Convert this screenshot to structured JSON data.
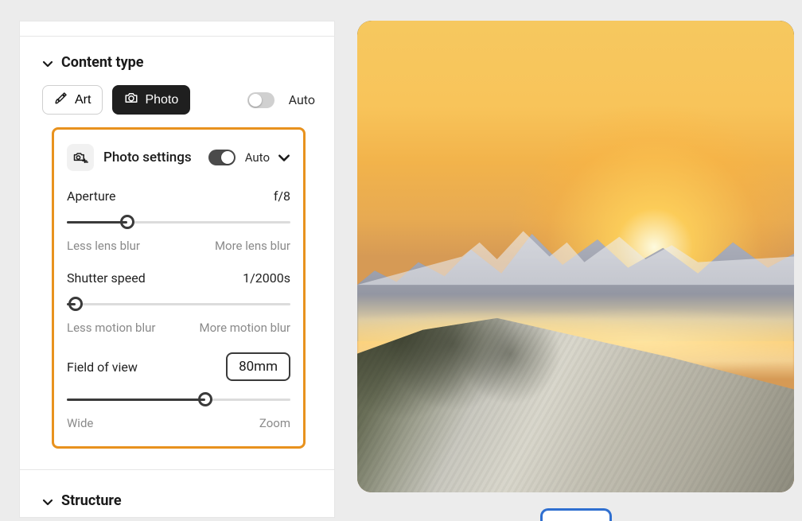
{
  "sections": {
    "content_type": {
      "title": "Content type"
    },
    "structure": {
      "title": "Structure"
    }
  },
  "type_buttons": {
    "art": {
      "label": "Art"
    },
    "photo": {
      "label": "Photo"
    }
  },
  "type_auto": {
    "label": "Auto",
    "on": false
  },
  "photo_settings": {
    "title": "Photo settings",
    "auto": {
      "label": "Auto",
      "on": true
    },
    "aperture": {
      "label": "Aperture",
      "value": "f/8",
      "percent": 27,
      "hint_low": "Less lens blur",
      "hint_high": "More lens blur"
    },
    "shutter": {
      "label": "Shutter speed",
      "value": "1/2000s",
      "percent": 4,
      "hint_low": "Less motion blur",
      "hint_high": "More motion blur"
    },
    "fov": {
      "label": "Field of view",
      "value": "80mm",
      "percent": 62,
      "hint_low": "Wide",
      "hint_high": "Zoom"
    }
  },
  "colors": {
    "highlight": "#e8921e",
    "accent_blue": "#2f6fd0"
  }
}
